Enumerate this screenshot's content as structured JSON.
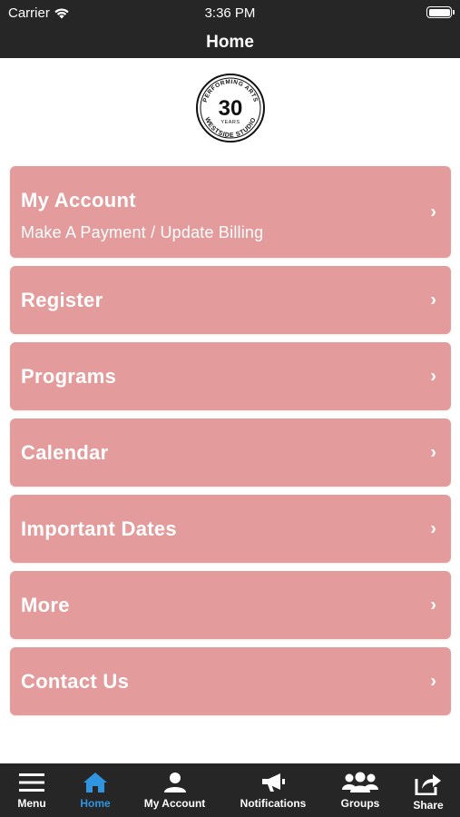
{
  "status_bar": {
    "carrier": "Carrier",
    "time": "3:36 PM",
    "icons": [
      "wifi-icon",
      "battery-icon"
    ]
  },
  "nav": {
    "title": "Home"
  },
  "logo": {
    "top_text": "PERFORMING ARTS",
    "number": "30",
    "years": "YEARS",
    "bottom_text": "WESTSIDE STUDIO"
  },
  "menu": {
    "accent_color": "#e39b9b",
    "items": [
      {
        "title": "My Account",
        "subtitle": "Make A Payment / Update Billing",
        "chevron": "›"
      },
      {
        "title": "Register",
        "chevron": "›"
      },
      {
        "title": "Programs",
        "chevron": "›"
      },
      {
        "title": "Calendar",
        "chevron": "›"
      },
      {
        "title": "Important Dates",
        "chevron": "›"
      },
      {
        "title": "More",
        "chevron": "›"
      },
      {
        "title": "Contact Us",
        "chevron": "›"
      }
    ]
  },
  "tab_bar": {
    "active_color": "#2f95e0",
    "tabs": [
      {
        "label": "Menu",
        "icon": "hamburger-icon"
      },
      {
        "label": "Home",
        "icon": "home-icon",
        "active": true
      },
      {
        "label": "My Account",
        "icon": "user-icon"
      },
      {
        "label": "Notifications",
        "icon": "megaphone-icon"
      },
      {
        "label": "Groups",
        "icon": "group-icon"
      },
      {
        "label": "Share",
        "icon": "share-icon"
      }
    ]
  }
}
